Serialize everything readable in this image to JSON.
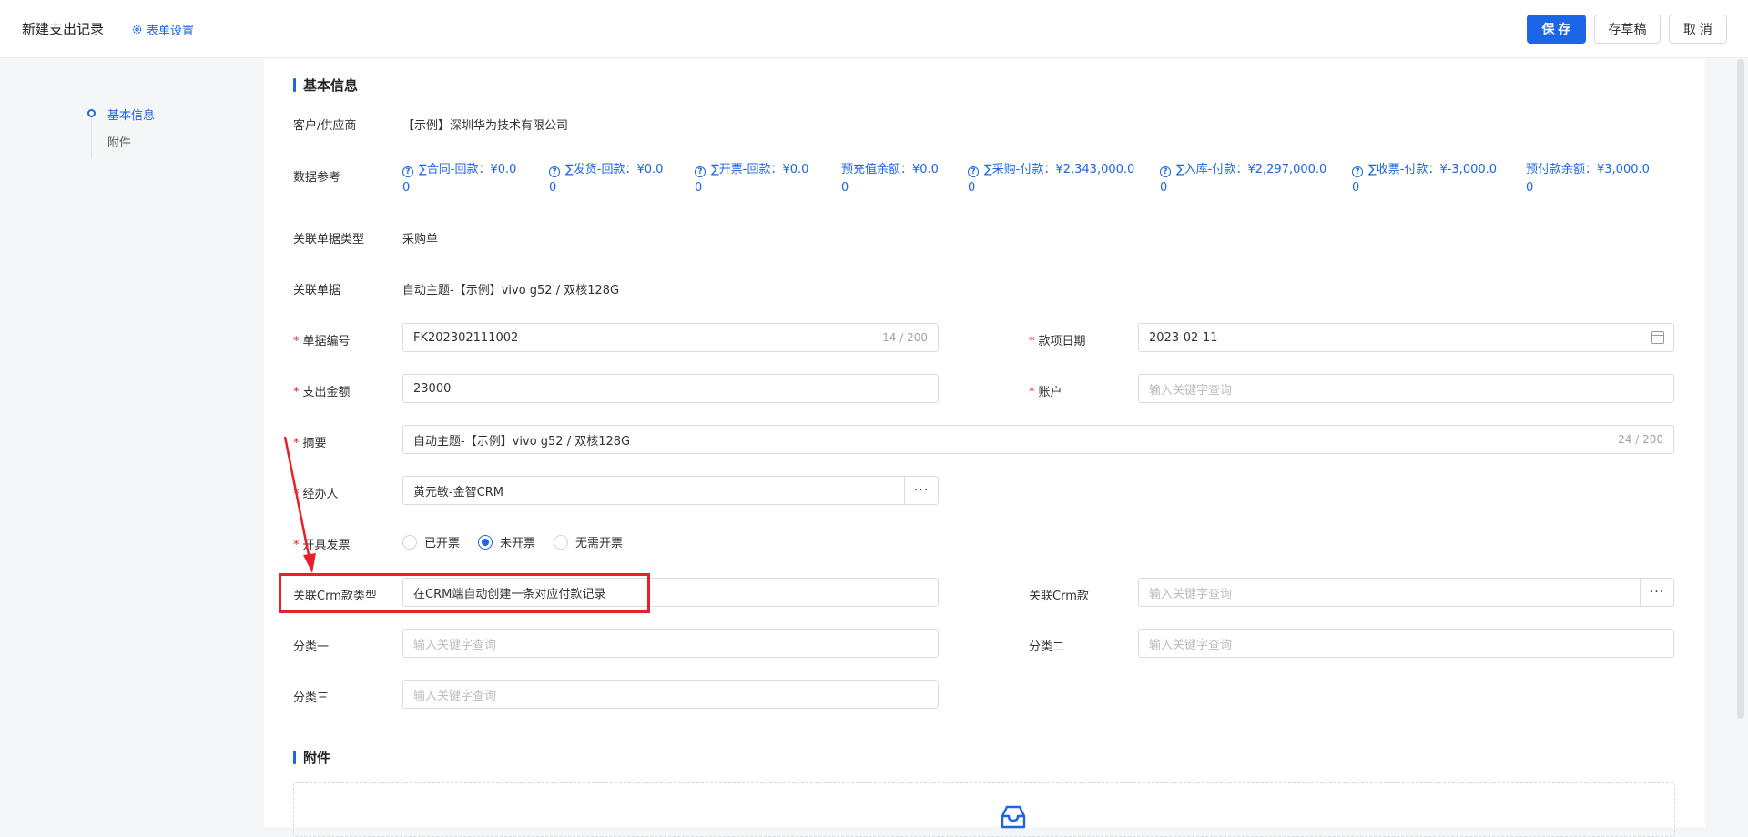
{
  "header": {
    "title": "新建支出记录",
    "settings_label": "表单设置",
    "save_label": "保 存",
    "draft_label": "存草稿",
    "cancel_label": "取 消"
  },
  "sidenav": {
    "items": [
      {
        "label": "基本信息",
        "active": true
      },
      {
        "label": "附件",
        "active": false
      }
    ]
  },
  "basic": {
    "section_title": "基本信息",
    "customer_label": "客户/供应商",
    "customer_value": "【示例】深圳华为技术有限公司",
    "ref_label": "数据参考",
    "refs": [
      {
        "line1": "∑合同-回款：¥0.0",
        "line2": "0",
        "has_icon": true
      },
      {
        "line1": "∑发货-回款：¥0.0",
        "line2": "0",
        "has_icon": true
      },
      {
        "line1": "∑开票-回款：¥0.0",
        "line2": "0",
        "has_icon": true
      },
      {
        "line1": "预充值余额：¥0.0",
        "line2": "0",
        "has_icon": false
      },
      {
        "line1": "∑采购-付款：¥2,343,000.0",
        "line2": "0",
        "has_icon": true
      },
      {
        "line1": "∑入库-付款：¥2,297,000.0",
        "line2": "0",
        "has_icon": true
      },
      {
        "line1": "∑收票-付款：¥-3,000.0",
        "line2": "0",
        "has_icon": true
      },
      {
        "line1": "预付款余额：¥3,000.0",
        "line2": "0",
        "has_icon": false
      }
    ],
    "doc_type_label": "关联单据类型",
    "doc_type_value": "采购单",
    "doc_label": "关联单据",
    "doc_value": "自动主题-【示例】vivo g52 / 双核128G",
    "number_label": "单据编号",
    "number_value": "FK202302111002",
    "number_count": "14 / 200",
    "date_label": "款项日期",
    "date_value": "2023-02-11",
    "amount_label": "支出金额",
    "amount_value": "23000",
    "account_label": "账户",
    "account_placeholder": "输入关键字查询",
    "summary_label": "摘要",
    "summary_value": "自动主题-【示例】vivo g52 / 双核128G",
    "summary_count": "24 / 200",
    "handler_label": "经办人",
    "handler_value": "黄元敏-金智CRM",
    "dots": "···",
    "invoice_label": "开具发票",
    "invoice_options": [
      {
        "label": "已开票",
        "checked": false
      },
      {
        "label": "未开票",
        "checked": true
      },
      {
        "label": "无需开票",
        "checked": false
      }
    ],
    "crm_type_label": "关联Crm款类型",
    "crm_type_value": "在CRM端自动创建一条对应付款记录",
    "crm_label": "关联Crm款",
    "crm_placeholder": "输入关键字查询",
    "cat1_label": "分类一",
    "cat1_placeholder": "输入关键字查询",
    "cat2_label": "分类二",
    "cat2_placeholder": "输入关键字查询",
    "cat3_label": "分类三",
    "cat3_placeholder": "输入关键字查询"
  },
  "attachment": {
    "section_title": "附件"
  },
  "colors": {
    "accent": "#1a66e6",
    "required": "#e02424",
    "annotation": "#e8202a"
  }
}
